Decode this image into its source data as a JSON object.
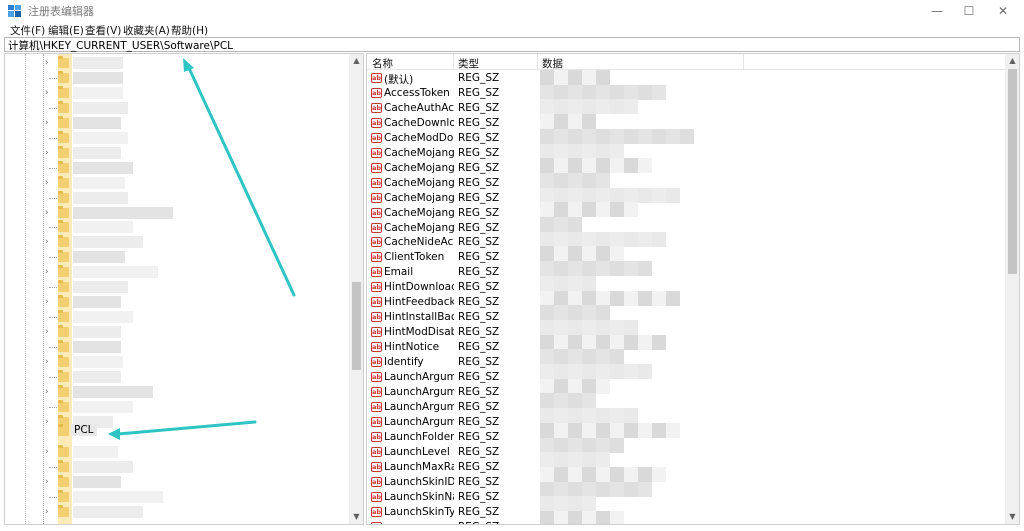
{
  "window": {
    "title": "注册表编辑器",
    "minimize_glyph": "—",
    "maximize_glyph": "☐",
    "close_glyph": "✕"
  },
  "menu": [
    "文件(F)",
    "编辑(E)",
    "查看(V)",
    "收藏夹(A)",
    "帮助(H)"
  ],
  "address": "计算机\\HKEY_CURRENT_USER\\Software\\PCL",
  "tree": {
    "selected_key": "PCL",
    "expand_glyph": "›",
    "scroll_up": "▲",
    "scroll_down": "▼"
  },
  "list": {
    "columns": [
      "名称",
      "类型",
      "数据"
    ],
    "icon_text": "ab",
    "rows": [
      {
        "name": "(默认)",
        "type": "REG_SZ"
      },
      {
        "name": "AccessToken",
        "type": "REG_SZ"
      },
      {
        "name": "CacheAuthAcc...",
        "type": "REG_SZ"
      },
      {
        "name": "CacheDownloa...",
        "type": "REG_SZ"
      },
      {
        "name": "CacheModDo...",
        "type": "REG_SZ"
      },
      {
        "name": "CacheMojang...",
        "type": "REG_SZ"
      },
      {
        "name": "CacheMojang...",
        "type": "REG_SZ"
      },
      {
        "name": "CacheMojang...",
        "type": "REG_SZ"
      },
      {
        "name": "CacheMojangP...",
        "type": "REG_SZ"
      },
      {
        "name": "CacheMojang...",
        "type": "REG_SZ"
      },
      {
        "name": "CacheMojang...",
        "type": "REG_SZ"
      },
      {
        "name": "CacheNideAcc...",
        "type": "REG_SZ"
      },
      {
        "name": "ClientToken",
        "type": "REG_SZ"
      },
      {
        "name": "Email",
        "type": "REG_SZ"
      },
      {
        "name": "HintDownload...",
        "type": "REG_SZ"
      },
      {
        "name": "HintFeedback",
        "type": "REG_SZ"
      },
      {
        "name": "HintInstallBack",
        "type": "REG_SZ"
      },
      {
        "name": "HintModDisable",
        "type": "REG_SZ"
      },
      {
        "name": "HintNotice",
        "type": "REG_SZ"
      },
      {
        "name": "Identify",
        "type": "REG_SZ"
      },
      {
        "name": "LaunchArgume...",
        "type": "REG_SZ"
      },
      {
        "name": "LaunchArgume...",
        "type": "REG_SZ"
      },
      {
        "name": "LaunchArgume...",
        "type": "REG_SZ"
      },
      {
        "name": "LaunchArgume...",
        "type": "REG_SZ"
      },
      {
        "name": "LaunchFolders",
        "type": "REG_SZ"
      },
      {
        "name": "LaunchLevel",
        "type": "REG_SZ"
      },
      {
        "name": "LaunchMaxRam",
        "type": "REG_SZ"
      },
      {
        "name": "LaunchSkinID",
        "type": "REG_SZ"
      },
      {
        "name": "LaunchSkinNa...",
        "type": "REG_SZ"
      },
      {
        "name": "LaunchSkinType",
        "type": "REG_SZ"
      },
      {
        "name": "",
        "type": "REG_SZ"
      }
    ]
  },
  "colors": {
    "annotation_arrow": "#2ec4c4",
    "folder": "#f3cf70",
    "reg_icon": "#cc3333"
  }
}
